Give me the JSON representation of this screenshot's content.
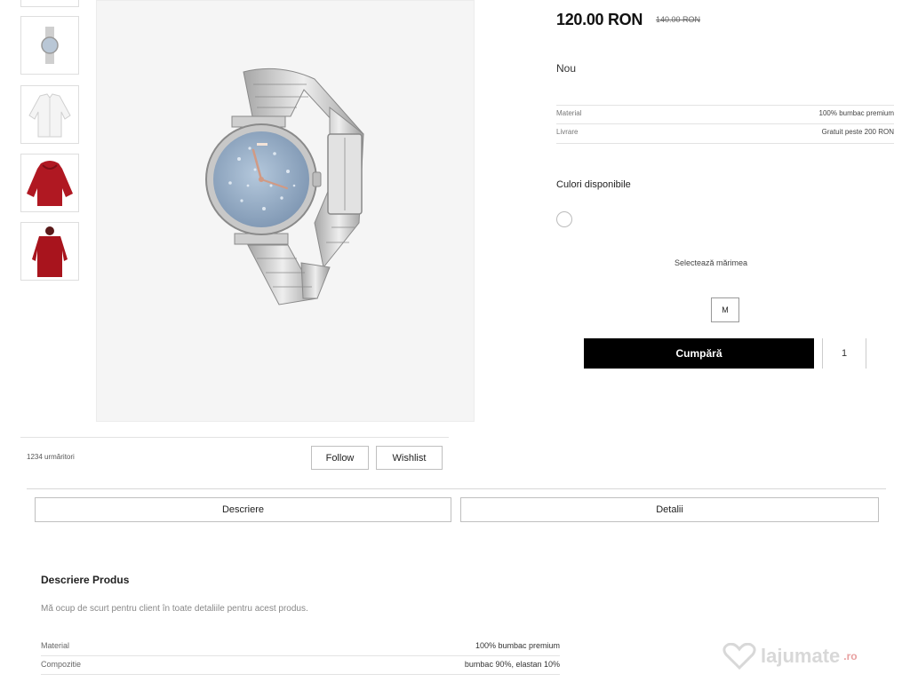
{
  "gallery": {
    "thumbnails": [
      {
        "name": "top-partial"
      },
      {
        "name": "watch"
      },
      {
        "name": "white-jacket"
      },
      {
        "name": "red-hoodie"
      },
      {
        "name": "red-jacket-back"
      }
    ]
  },
  "product": {
    "price": "120.00 RON",
    "old_price": "140.00 RON",
    "condition": "Nou",
    "specs": [
      {
        "label": "Material",
        "value": "100% bumbac premium"
      },
      {
        "label": "Livrare",
        "value": "Gratuit peste 200 RON"
      }
    ],
    "colors_label": "Culori disponibile",
    "size_label": "Selectează mărimea",
    "size_value": "M",
    "buy_label": "Cumpără",
    "quantity": "1"
  },
  "seller": {
    "info": "1234 urmăritori",
    "follow_label": "Follow",
    "wishlist_label": "Wishlist"
  },
  "tabs": [
    {
      "label": "Descriere"
    },
    {
      "label": "Detalii"
    }
  ],
  "description": {
    "title": "Descriere Produs",
    "text": "Mă ocup de scurt pentru client în toate detaliile pentru acest produs.",
    "specs": [
      {
        "label": "Material",
        "value": "100% bumbac premium"
      },
      {
        "label": "Compozitie",
        "value": "bumbac 90%, elastan 10%"
      }
    ]
  },
  "watermark": {
    "brand": "lajumate",
    "suffix": ".ro"
  }
}
